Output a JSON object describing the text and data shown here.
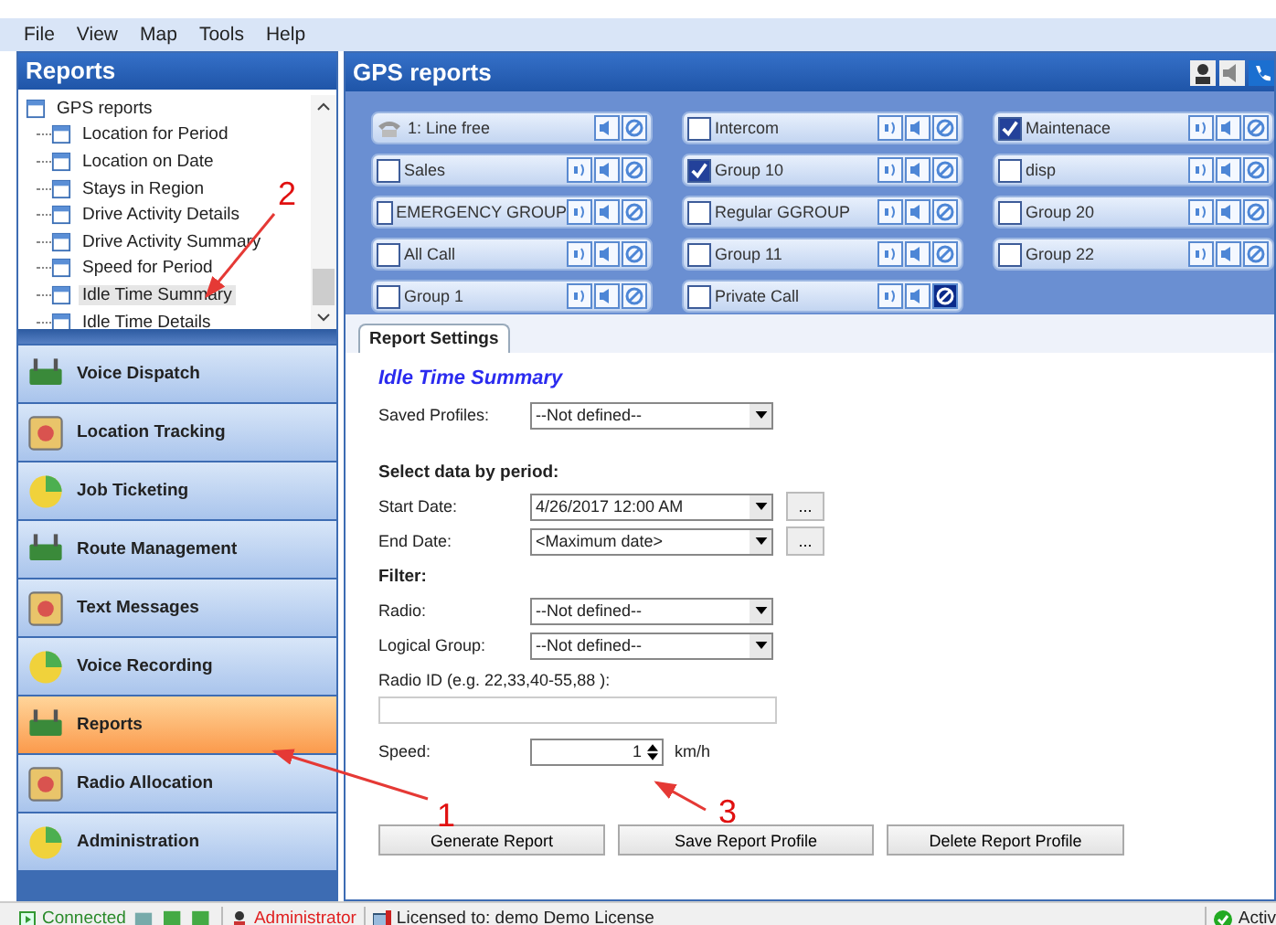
{
  "menu": [
    "File",
    "View",
    "Map",
    "Tools",
    "Help"
  ],
  "left_panel": {
    "title": "Reports",
    "tree": {
      "label": "GPS reports",
      "children": [
        {
          "label": "Location for Period",
          "selected": false
        },
        {
          "label": "Location on Date",
          "selected": false
        },
        {
          "label": "Stays in Region",
          "selected": false
        },
        {
          "label": "Drive Activity Details",
          "selected": false
        },
        {
          "label": "Drive Activity Summary",
          "selected": false
        },
        {
          "label": "Speed for Period",
          "selected": false
        },
        {
          "label": "Idle Time Summary",
          "selected": true
        },
        {
          "label": "Idle Time Details",
          "selected": false
        }
      ]
    }
  },
  "nav": [
    {
      "label": "Voice Dispatch",
      "selected": false
    },
    {
      "label": "Location Tracking",
      "selected": false
    },
    {
      "label": "Job Ticketing",
      "selected": false
    },
    {
      "label": "Route Management",
      "selected": false
    },
    {
      "label": "Text Messages",
      "selected": false
    },
    {
      "label": "Voice Recording",
      "selected": false
    },
    {
      "label": "Reports",
      "selected": true
    },
    {
      "label": "Radio Allocation",
      "selected": false
    },
    {
      "label": "Administration",
      "selected": false
    }
  ],
  "main": {
    "title": "GPS reports",
    "group_columns": [
      [
        {
          "kind": "line",
          "label": "1: Line free",
          "blocked": false
        },
        {
          "kind": "group",
          "label": "Sales",
          "checked": false,
          "blocked": false
        },
        {
          "kind": "group",
          "label": "EMERGENCY GROUP",
          "checked": false,
          "blocked": false
        },
        {
          "kind": "group",
          "label": "All Call",
          "checked": false,
          "blocked": false
        },
        {
          "kind": "group",
          "label": "Group 1",
          "checked": false,
          "blocked": false
        }
      ],
      [
        {
          "kind": "group",
          "label": "Intercom",
          "checked": false,
          "blocked": false
        },
        {
          "kind": "group",
          "label": "Group 10",
          "checked": true,
          "blocked": false
        },
        {
          "kind": "group",
          "label": "Regular GGROUP",
          "checked": false,
          "blocked": false
        },
        {
          "kind": "group",
          "label": "Group 11",
          "checked": false,
          "blocked": false
        },
        {
          "kind": "group",
          "label": "Private Call",
          "checked": false,
          "blocked": true
        }
      ],
      [
        {
          "kind": "group",
          "label": "Maintenace",
          "checked": true,
          "blocked": false
        },
        {
          "kind": "group",
          "label": "disp",
          "checked": false,
          "blocked": false
        },
        {
          "kind": "group",
          "label": "Group 20",
          "checked": false,
          "blocked": false
        },
        {
          "kind": "group",
          "label": "Group 22",
          "checked": false,
          "blocked": false
        }
      ]
    ],
    "tabs": [
      {
        "label": "Report Settings",
        "selected": true
      }
    ],
    "report_title": "Idle Time Summary",
    "saved_profiles": {
      "label": "Saved Profiles:",
      "value": "--Not defined--"
    },
    "period_heading": "Select data by period:",
    "start_date": {
      "label": "Start Date:",
      "value": "4/26/2017 12:00 AM",
      "button": "..."
    },
    "end_date": {
      "label": "End Date:",
      "value": "<Maximum date>",
      "button": "..."
    },
    "filter_heading": "Filter:",
    "radio": {
      "label": "Radio:",
      "value": "--Not defined--"
    },
    "logical_group": {
      "label": "Logical Group:",
      "value": "--Not defined--"
    },
    "radio_id": {
      "label": "Radio ID (e.g. 22,33,40-55,88 ):"
    },
    "speed": {
      "label": "Speed:",
      "value": "1",
      "unit": "km/h"
    },
    "buttons": [
      "Generate Report",
      "Save Report Profile",
      "Delete Report Profile"
    ]
  },
  "status_bar": {
    "connected": "Connected",
    "user": "Administrator",
    "license": "Licensed to: demo Demo License",
    "status": "Activ"
  },
  "annotations": [
    "2",
    "1",
    "3"
  ]
}
